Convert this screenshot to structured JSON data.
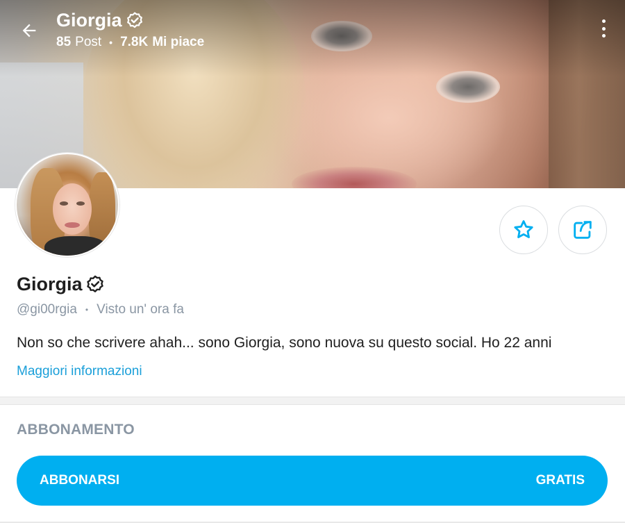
{
  "header": {
    "name": "Giorgia",
    "posts_count": "85",
    "posts_label": "Post",
    "likes_count": "7.8K",
    "likes_label": "Mi piace"
  },
  "profile": {
    "name": "Giorgia",
    "handle": "@gi00rgia",
    "last_seen": "Visto un' ora fa",
    "bio": "Non so che scrivere ahah... sono Giorgia, sono nuova su questo social. Ho 22 anni",
    "more_info_label": "Maggiori informazioni"
  },
  "subscription": {
    "section_title": "ABBONAMENTO",
    "button_label": "ABBONARSI",
    "price_label": "GRATIS"
  },
  "icons": {
    "back": "arrow-left-icon",
    "more": "more-vertical-icon",
    "verified": "verified-badge-icon",
    "star": "star-icon",
    "share": "share-icon"
  },
  "colors": {
    "accent": "#00aff0",
    "link": "#1a9fd9",
    "muted": "#8a96a3",
    "text": "#1f1f1f"
  }
}
